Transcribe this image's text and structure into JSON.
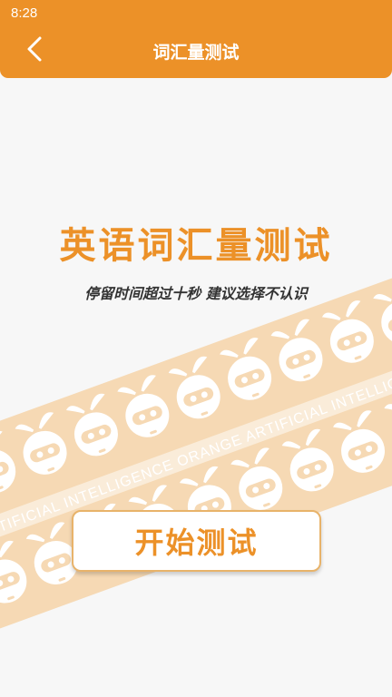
{
  "status_bar": {
    "time": "8:28"
  },
  "header": {
    "title": "词汇量测试",
    "back_icon": "chevron-left-icon"
  },
  "main": {
    "title": "英语词汇量测试",
    "subtitle": "停留时间超过十秒 建议选择不认识",
    "banner_text": "ORANGE ARTIFICIAL INTELLIGENCE  ORANGE ARTIFICIAL INTELLIGENCE  ORANGE ARTIFICIAL INTELLIGENCE",
    "start_button": "开始测试"
  },
  "colors": {
    "accent": "#ec9128",
    "band": "#f6d9b4",
    "band_strip": "#faecd9",
    "mascot": "#ffffff",
    "background": "#f7f7f7"
  }
}
